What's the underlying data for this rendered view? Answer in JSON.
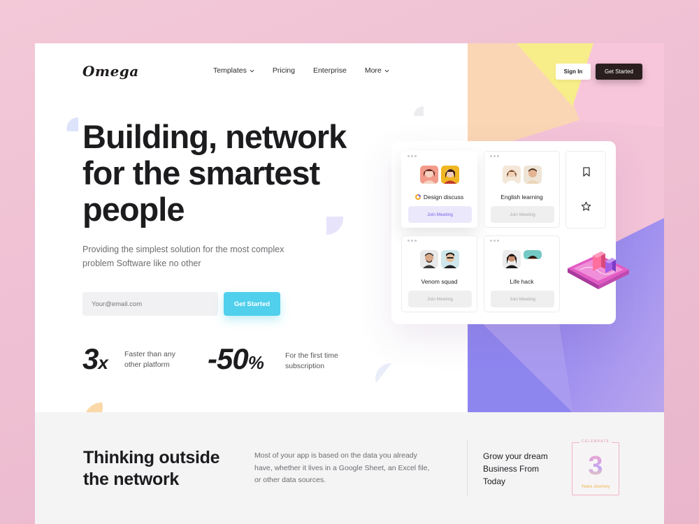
{
  "brand": {
    "logo": "Omega"
  },
  "nav": {
    "items": [
      {
        "label": "Templates",
        "dropdown": true
      },
      {
        "label": "Pricing",
        "dropdown": false
      },
      {
        "label": "Enterprise",
        "dropdown": false
      },
      {
        "label": "More",
        "dropdown": true
      }
    ],
    "signin": "Sign In",
    "get_started": "Get Started"
  },
  "hero": {
    "title_line1": "Building, network",
    "title_line2": "for the smartest",
    "title_line3": "people",
    "subtitle_line1": "Providing the simplest solution for the most complex",
    "subtitle_line2": "problem Software like no other",
    "email_placeholder": "Your@email.com",
    "cta": "Get Started"
  },
  "stats": [
    {
      "value": "3",
      "suffix": "x",
      "text_line1": "Faster than any",
      "text_line2": "other platform"
    },
    {
      "value": "-50",
      "suffix": "%",
      "text_line1": "For the first time",
      "text_line2": "subscription"
    }
  ],
  "meetings": [
    {
      "title": "Design discuss",
      "button": "Join Meeting",
      "active": true
    },
    {
      "title": "English learning",
      "button": "Join Meeting",
      "active": false
    },
    {
      "title": "Venom squad",
      "button": "Join Meeting",
      "active": false
    },
    {
      "title": "Life hack",
      "button": "Join Meeting",
      "active": false
    }
  ],
  "side_icons": [
    "bookmark-icon",
    "star-icon"
  ],
  "bottom": {
    "title_line1": "Thinking outside",
    "title_line2": "the network",
    "desc_line1": "Most of your app is based on the data you already",
    "desc_line2": "have, whether it lives in a Google Sheet, an Excel file,",
    "desc_line3": "or other data sources.",
    "grow_line1": "Grow your dream",
    "grow_line2": "Business From",
    "grow_line3": "Today",
    "badge_top": "CELEBRATE",
    "badge_number": "3",
    "badge_sub": "Years Journey"
  },
  "colors": {
    "accent_cyan": "#50d0ec",
    "dark_button": "#2a1e1e",
    "purple": "#7a62e6",
    "pink_panel": "#f7c4d9"
  }
}
